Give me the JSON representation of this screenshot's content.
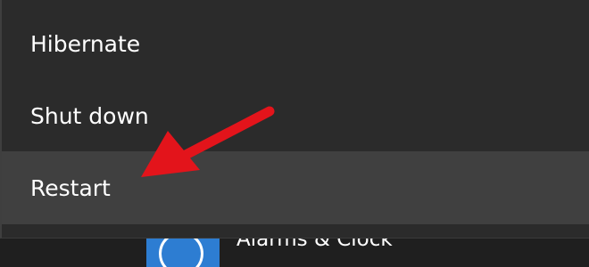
{
  "power_menu": {
    "items": [
      {
        "label": "Hibernate",
        "highlighted": false
      },
      {
        "label": "Shut down",
        "highlighted": false
      },
      {
        "label": "Restart",
        "highlighted": true
      }
    ]
  },
  "underlying_start_menu": {
    "app_label": "Alarms & Clock",
    "tile_color": "#2d7dd2",
    "icon": "alarm-clock-icon"
  },
  "annotation": {
    "arrow_color": "#e3141b",
    "points_to": "Restart"
  },
  "colors": {
    "menu_background": "#2b2b2b",
    "highlight_background": "#404040",
    "text": "#ffffff"
  }
}
